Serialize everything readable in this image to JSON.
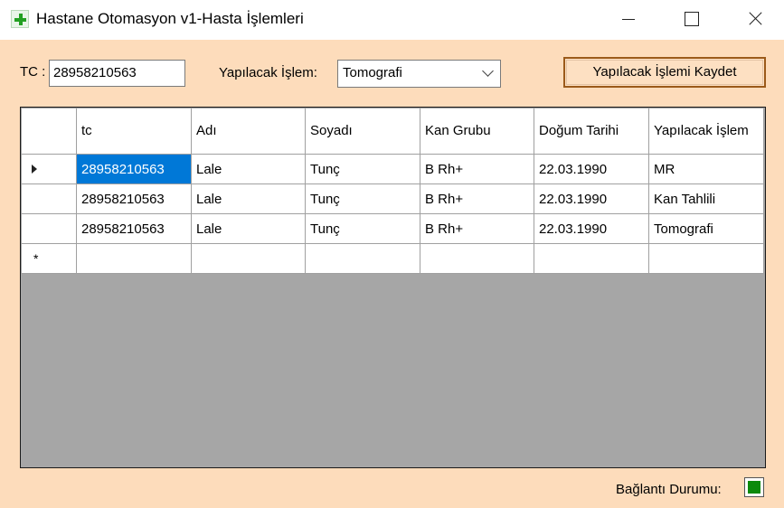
{
  "window": {
    "title": "Hastane Otomasyon v1-Hasta İşlemleri",
    "icon": "green-plus-icon"
  },
  "form": {
    "tc_label": "TC :",
    "tc_value": "28958210563",
    "operation_label": "Yapılacak İşlem:",
    "operation_value": "Tomografi",
    "save_button": "Yapılacak İşlemi Kaydet"
  },
  "grid": {
    "headers": [
      "tc",
      "Adı",
      "Soyadı",
      "Kan Grubu",
      "Doğum Tarihi",
      "Yapılacak İşlem"
    ],
    "rows": [
      [
        "28958210563",
        "Lale",
        "Tunç",
        "B Rh+",
        "22.03.1990",
        "MR"
      ],
      [
        "28958210563",
        "Lale",
        "Tunç",
        "B Rh+",
        "22.03.1990",
        "Kan Tahlili"
      ],
      [
        "28958210563",
        "Lale",
        "Tunç",
        "B Rh+",
        "22.03.1990",
        "Tomografi"
      ]
    ],
    "new_row_marker": "*"
  },
  "status": {
    "label": "Bağlantı Durumu:",
    "color": "#0c8a0c"
  }
}
